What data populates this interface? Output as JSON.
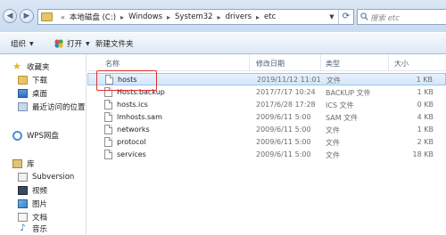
{
  "address": {
    "crumbs": [
      "本地磁盘 (C:)",
      "Windows",
      "System32",
      "drivers",
      "etc"
    ],
    "lead_sep": "«",
    "sep": "▸"
  },
  "search": {
    "placeholder": "搜索 etc"
  },
  "toolbar": {
    "organize_label": "组织",
    "open_label": "打开",
    "new_folder_label": "新建文件夹"
  },
  "nav": {
    "favorites": {
      "label": "收藏夹",
      "items": [
        "下载",
        "桌面",
        "最近访问的位置"
      ]
    },
    "wps": "WPS网盘",
    "libraries": {
      "label": "库",
      "items": [
        "Subversion",
        "视频",
        "图片",
        "文档",
        "音乐"
      ]
    }
  },
  "columns": {
    "name": "名称",
    "modified": "修改日期",
    "type": "类型",
    "size": "大小"
  },
  "files": [
    {
      "name": "hosts",
      "modified": "2019/11/12 11:01",
      "type": "文件",
      "size": "1 KB",
      "selected": true
    },
    {
      "name": "Hosts.backup",
      "modified": "2017/7/17 10:24",
      "type": "BACKUP 文件",
      "size": "1 KB"
    },
    {
      "name": "hosts.ics",
      "modified": "2017/6/28 17:28",
      "type": "ICS 文件",
      "size": "0 KB"
    },
    {
      "name": "lmhosts.sam",
      "modified": "2009/6/11 5:00",
      "type": "SAM 文件",
      "size": "4 KB"
    },
    {
      "name": "networks",
      "modified": "2009/6/11 5:00",
      "type": "文件",
      "size": "1 KB"
    },
    {
      "name": "protocol",
      "modified": "2009/6/11 5:00",
      "type": "文件",
      "size": "2 KB"
    },
    {
      "name": "services",
      "modified": "2009/6/11 5:00",
      "type": "文件",
      "size": "18 KB"
    }
  ]
}
